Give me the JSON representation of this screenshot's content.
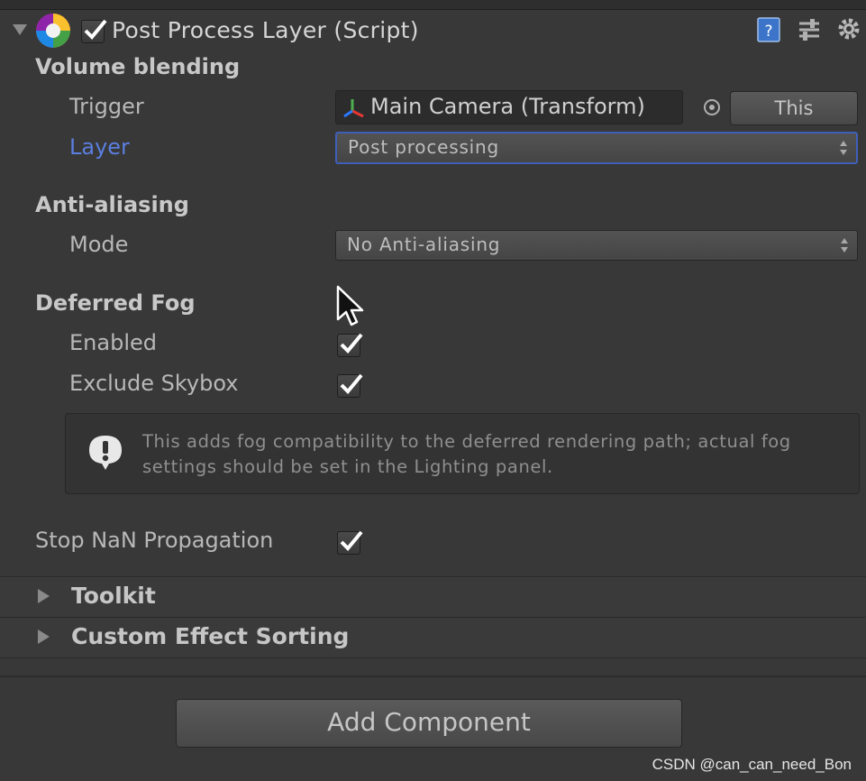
{
  "component": {
    "title": "Post Process Layer (Script)",
    "enabled": true
  },
  "sections": {
    "volume_blending": "Volume blending",
    "anti_aliasing": "Anti-aliasing",
    "deferred_fog": "Deferred Fog"
  },
  "fields": {
    "trigger_label": "Trigger",
    "trigger_value": "Main Camera (Transform)",
    "this_button": "This",
    "layer_label": "Layer",
    "layer_value": "Post processing",
    "mode_label": "Mode",
    "mode_value": "No Anti-aliasing",
    "enabled_label": "Enabled",
    "enabled_checked": true,
    "exclude_skybox_label": "Exclude Skybox",
    "exclude_skybox_checked": true,
    "help_text": "This adds fog compatibility to the deferred rendering path; actual fog settings should be set in the Lighting panel.",
    "stop_nan_label": "Stop NaN Propagation",
    "stop_nan_checked": true
  },
  "foldouts": {
    "toolkit": "Toolkit",
    "custom_effect_sorting": "Custom Effect Sorting"
  },
  "add_component": "Add Component",
  "watermark": "CSDN @can_can_need_Bon",
  "colors": {
    "background": "#383838",
    "layer_label_blue": "#5b7fe0",
    "focus_border": "#3f5fb8"
  },
  "icons": [
    "fold-arrow-down",
    "post-process-layer-icon",
    "checkbox-check",
    "help-book-icon",
    "preset-sliders-icon",
    "gear-icon",
    "transform-axis-icon",
    "object-picker-icon",
    "warning-icon",
    "fold-arrow-right",
    "mouse-cursor"
  ]
}
